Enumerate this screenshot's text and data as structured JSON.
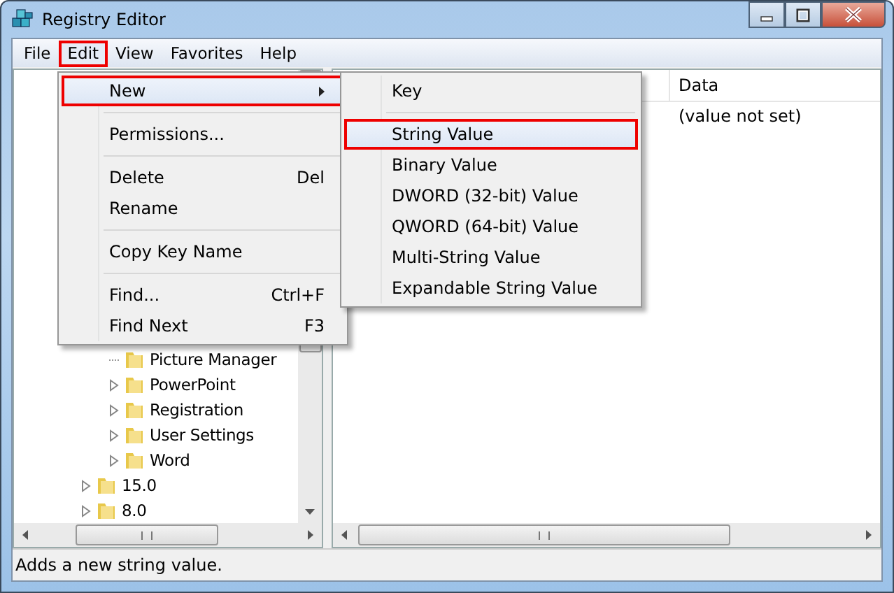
{
  "window": {
    "title": "Registry Editor"
  },
  "menu_bar": [
    {
      "label": "File",
      "highlighted": false
    },
    {
      "label": "Edit",
      "highlighted": true
    },
    {
      "label": "View",
      "highlighted": false
    },
    {
      "label": "Favorites",
      "highlighted": false
    },
    {
      "label": "Help",
      "highlighted": false
    }
  ],
  "edit_menu": [
    {
      "kind": "item",
      "label": "New",
      "submenu": true,
      "highlighted": true
    },
    {
      "kind": "separator"
    },
    {
      "kind": "item",
      "label": "Permissions...",
      "submenu": false,
      "highlighted": false
    },
    {
      "kind": "separator"
    },
    {
      "kind": "item",
      "label": "Delete",
      "shortcut": "Del",
      "submenu": false,
      "highlighted": false
    },
    {
      "kind": "item",
      "label": "Rename",
      "submenu": false,
      "highlighted": false
    },
    {
      "kind": "separator"
    },
    {
      "kind": "item",
      "label": "Copy Key Name",
      "submenu": false,
      "highlighted": false
    },
    {
      "kind": "separator"
    },
    {
      "kind": "item",
      "label": "Find...",
      "shortcut": "Ctrl+F",
      "submenu": false,
      "highlighted": false
    },
    {
      "kind": "item",
      "label": "Find Next",
      "shortcut": "F3",
      "submenu": false,
      "highlighted": false
    }
  ],
  "new_submenu": [
    {
      "kind": "item",
      "label": "Key",
      "highlighted": false
    },
    {
      "kind": "separator"
    },
    {
      "kind": "item",
      "label": "String Value",
      "highlighted": true
    },
    {
      "kind": "item",
      "label": "Binary Value",
      "highlighted": false
    },
    {
      "kind": "item",
      "label": "DWORD (32-bit) Value",
      "highlighted": false
    },
    {
      "kind": "item",
      "label": "QWORD (64-bit) Value",
      "highlighted": false
    },
    {
      "kind": "item",
      "label": "Multi-String Value",
      "highlighted": false
    },
    {
      "kind": "item",
      "label": "Expandable String Value",
      "highlighted": false
    }
  ],
  "tree": [
    {
      "children": [
        {
          "label": "Picture Manager",
          "expandable": false
        },
        {
          "label": "PowerPoint",
          "expandable": true
        },
        {
          "label": "Registration",
          "expandable": true
        },
        {
          "label": "User Settings",
          "expandable": true
        },
        {
          "label": "Word",
          "expandable": true
        }
      ]
    },
    {
      "label": "15.0",
      "expandable": true
    },
    {
      "label": "8.0",
      "expandable": true
    }
  ],
  "values_list": {
    "columns": [
      "Data"
    ],
    "rows": [
      [
        "(value not set)"
      ]
    ]
  },
  "status_bar": "Adds a new string value."
}
